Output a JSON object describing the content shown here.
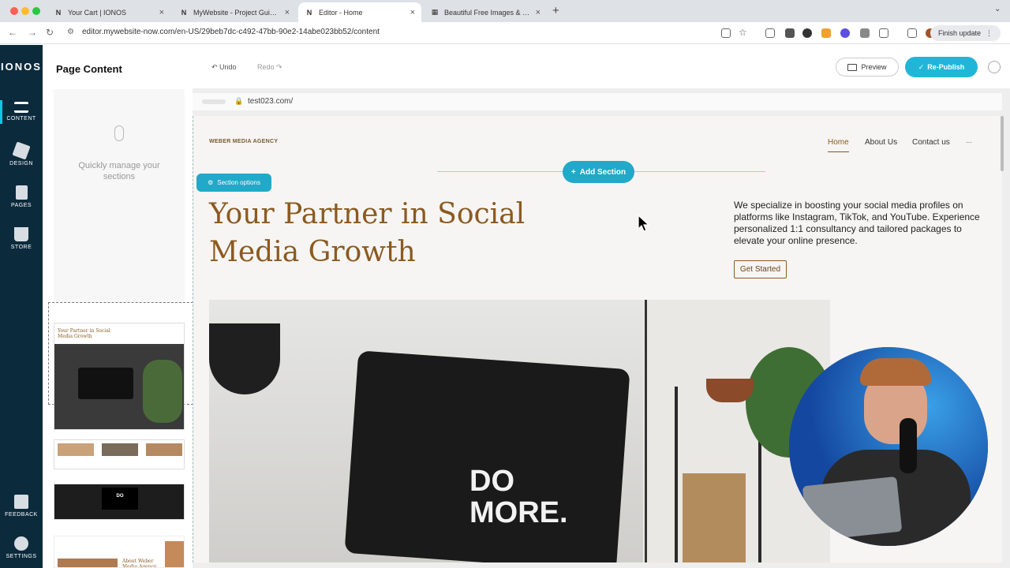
{
  "browser": {
    "tabs": [
      {
        "label": "Your Cart | IONOS",
        "fav": "N"
      },
      {
        "label": "MyWebsite - Project Guidanc",
        "fav": "N"
      },
      {
        "label": "Editor - Home",
        "fav": "N"
      },
      {
        "label": "Beautiful Free Images & Pictu",
        "fav": "▦"
      }
    ],
    "url": "editor.mywebsite-now.com/en-US/29beb7dc-c492-47bb-90e2-14abe023bb52/content",
    "finish_update": "Finish update"
  },
  "rail": {
    "logo": "IONOS",
    "items": [
      {
        "label": "CONTENT",
        "icon": "content-icon"
      },
      {
        "label": "DESIGN",
        "icon": "design-icon"
      },
      {
        "label": "PAGES",
        "icon": "pages-icon"
      },
      {
        "label": "STORE",
        "icon": "cart-icon"
      },
      {
        "label": "FEEDBACK",
        "icon": "feedback-icon"
      },
      {
        "label": "SETTINGS",
        "icon": "gear-icon"
      }
    ]
  },
  "panel": {
    "title": "Page Content",
    "hint": "Quickly manage your sections",
    "thumbs": [
      {
        "text": "Your Partner in Social Media Growth"
      },
      {
        "text": "About Weber Media Agency"
      }
    ]
  },
  "editor": {
    "undo": "Undo",
    "redo": "Redo",
    "preview": "Preview",
    "publish": "Re-Publish",
    "site_url": "test023.com/",
    "add_section": "Add Section",
    "section_options": "Section options"
  },
  "site": {
    "brand": "WEBER MEDIA AGENCY",
    "nav": [
      "Home",
      "About Us",
      "Contact us",
      "···"
    ],
    "headline": "Your Partner in Social Media Growth",
    "description": "We specialize in boosting your social media profiles on platforms like Instagram, TikTok, and YouTube. Experience personalized 1:1 consultancy and tailored packages to elevate your online presence.",
    "cta": "Get Started",
    "hero_text_1": "DO",
    "hero_text_2": "MORE."
  },
  "colors": {
    "brand_brown": "#8b5a21",
    "ionos_navy": "#0b2a3c",
    "accent_teal": "#21a9c9"
  }
}
